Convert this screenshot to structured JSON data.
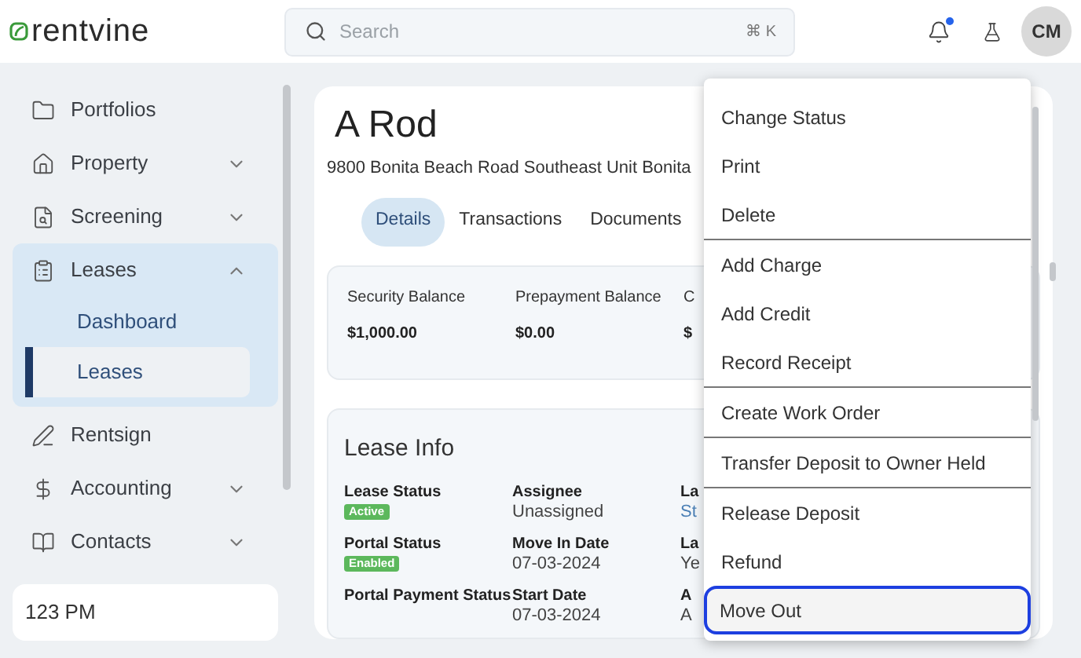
{
  "header": {
    "logo": "rentvine",
    "search": {
      "placeholder": "Search",
      "shortcut": "⌘ K"
    },
    "notification_dot": true,
    "avatar": "CM"
  },
  "sidebar": {
    "items": [
      {
        "label": "Portfolios"
      },
      {
        "label": "Property",
        "expanded": false
      },
      {
        "label": "Screening",
        "expanded": false
      },
      {
        "label": "Leases",
        "expanded": true,
        "children": [
          {
            "label": "Dashboard",
            "selected": false
          },
          {
            "label": "Leases",
            "selected": true
          }
        ]
      },
      {
        "label": "Rentsign"
      },
      {
        "label": "Accounting",
        "expanded": false
      },
      {
        "label": "Contacts",
        "expanded": false
      }
    ],
    "footer": "123 PM"
  },
  "lease": {
    "title": "A Rod",
    "address": "9800 Bonita Beach Road Southeast Unit Bonita",
    "tabs": [
      {
        "label": "Details",
        "selected": true
      },
      {
        "label": "Transactions",
        "selected": false
      },
      {
        "label": "Documents",
        "selected": false
      }
    ],
    "balances": [
      {
        "label": "Security Balance",
        "value": "$1,000.00"
      },
      {
        "label": "Prepayment Balance",
        "value": "$0.00"
      },
      {
        "label": "C",
        "value": "$"
      }
    ],
    "lease_info": {
      "title": "Lease Info",
      "columns": [
        [
          {
            "label": "Lease Status",
            "badge": "Active"
          },
          {
            "label": "Portal Status",
            "badge": "Enabled"
          },
          {
            "label": "Portal Payment Status"
          }
        ],
        [
          {
            "label": "Assignee",
            "value": "Unassigned"
          },
          {
            "label": "Move In Date",
            "value": "07-03-2024"
          },
          {
            "label": "Start Date",
            "value": "07-03-2024"
          }
        ],
        [
          {
            "label": "La",
            "value": "St",
            "link": true
          },
          {
            "label": "La",
            "value": "Ye",
            "link": false
          },
          {
            "label": "A",
            "value": "A",
            "link": false
          }
        ]
      ]
    }
  },
  "menu": {
    "items": [
      {
        "label": "Change Status",
        "divider_after": false,
        "selected": false
      },
      {
        "label": "Print",
        "divider_after": false,
        "selected": false
      },
      {
        "label": "Delete",
        "divider_after": true,
        "selected": false
      },
      {
        "label": "Add Charge",
        "divider_after": false,
        "selected": false
      },
      {
        "label": "Add Credit",
        "divider_after": false,
        "selected": false
      },
      {
        "label": "Record Receipt",
        "divider_after": true,
        "selected": false
      },
      {
        "label": "Create Work Order",
        "divider_after": true,
        "selected": false
      },
      {
        "label": "Transfer Deposit to Owner Held",
        "divider_after": true,
        "selected": false
      },
      {
        "label": "Release Deposit",
        "divider_after": false,
        "selected": false
      },
      {
        "label": "Refund",
        "divider_after": false,
        "selected": false
      },
      {
        "label": "Move Out",
        "divider_after": false,
        "selected": true
      }
    ]
  }
}
